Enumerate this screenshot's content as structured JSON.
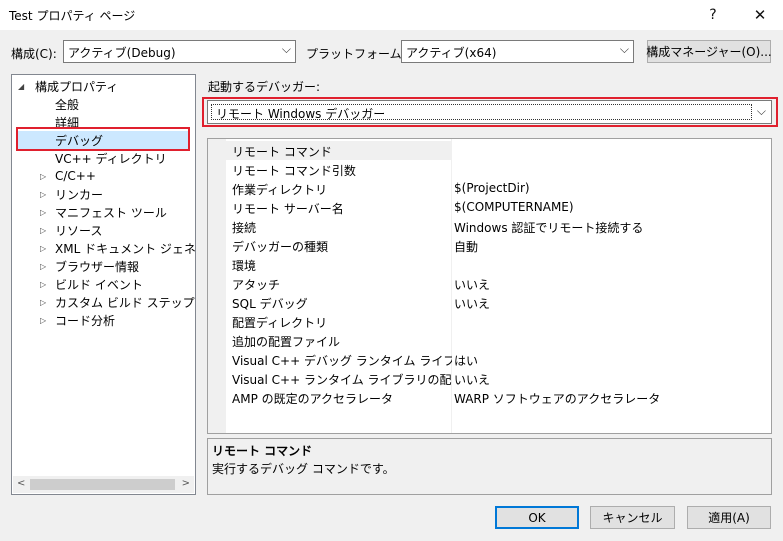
{
  "window": {
    "title": "Test プロパティ ページ",
    "help_glyph": "?",
    "close_glyph": "✕"
  },
  "config": {
    "label": "構成(C):",
    "value": "アクティブ(Debug)",
    "platform_label": "プラットフォーム(P):",
    "platform_value": "アクティブ(x64)",
    "manager_button": "構成マネージャー(O)..."
  },
  "tree": {
    "root": "構成プロパティ",
    "items": [
      "全般",
      "詳細",
      "デバッグ",
      "VC++ ディレクトリ"
    ],
    "expandable": [
      "C/C++",
      "リンカー",
      "マニフェスト ツール",
      "リソース",
      "XML ドキュメント ジェネレーター",
      "ブラウザー情報",
      "ビルド イベント",
      "カスタム ビルド ステップ",
      "コード分析"
    ]
  },
  "debugger": {
    "label": "起動するデバッガー:",
    "value": "リモート Windows デバッガー"
  },
  "properties": [
    {
      "name": "リモート コマンド",
      "value": ""
    },
    {
      "name": "リモート コマンド引数",
      "value": ""
    },
    {
      "name": "作業ディレクトリ",
      "value": "$(ProjectDir)"
    },
    {
      "name": "リモート サーバー名",
      "value": "$(COMPUTERNAME)"
    },
    {
      "name": "接続",
      "value": "Windows 認証でリモート接続する"
    },
    {
      "name": "デバッガーの種類",
      "value": "自動"
    },
    {
      "name": "環境",
      "value": ""
    },
    {
      "name": "アタッチ",
      "value": "いいえ"
    },
    {
      "name": "SQL デバッグ",
      "value": "いいえ"
    },
    {
      "name": "配置ディレクトリ",
      "value": ""
    },
    {
      "name": "追加の配置ファイル",
      "value": ""
    },
    {
      "name": "Visual C++ デバッグ ランタイム ライブラリの配置",
      "value": "はい"
    },
    {
      "name": "Visual C++ ランタイム ライブラリの配置",
      "value": "いいえ"
    },
    {
      "name": "AMP の既定のアクセラレータ",
      "value": "WARP ソフトウェアのアクセラレータ"
    }
  ],
  "description": {
    "title": "リモート コマンド",
    "text": "実行するデバッグ コマンドです。"
  },
  "buttons": {
    "ok": "OK",
    "cancel": "キャンセル",
    "apply": "適用(A)"
  },
  "colors": {
    "highlight_box": "#e0202e",
    "selection": "#cce8ff",
    "default_button_border": "#0078d7"
  }
}
